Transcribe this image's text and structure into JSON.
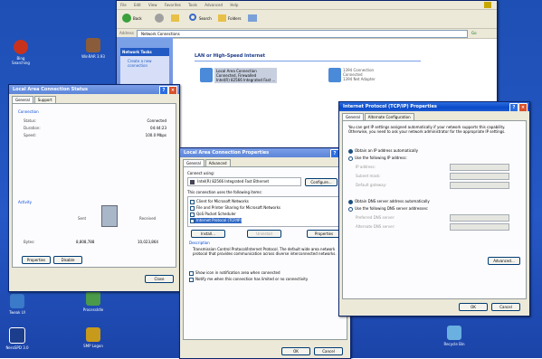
{
  "desktop": {
    "icons": [
      {
        "label": "Bing Searching",
        "color": "#c8321c"
      },
      {
        "label": "WinRAR 3.93",
        "color": "#8a5c3a"
      },
      {
        "label": "Tweak UI",
        "color": "#3a7ac8"
      },
      {
        "label": "ProcessIdle",
        "color": "#4a9a4a"
      },
      {
        "label": "NeroSPD 3.0",
        "color": "#1c3c8c"
      },
      {
        "label": "SMP Logon",
        "color": "#c89a1c"
      },
      {
        "label": "Recycle Bin",
        "color": "#6ab0e0"
      }
    ]
  },
  "explorer": {
    "menu": [
      "File",
      "Edit",
      "View",
      "Favorites",
      "Tools",
      "Advanced",
      "Help"
    ],
    "toolbar": {
      "back": "Back",
      "search": "Search",
      "folders": "Folders"
    },
    "address": {
      "label": "Address",
      "value": "Network Connections",
      "go": "Go"
    },
    "tasks_title": "Network Tasks",
    "tasks": [
      "Create a new connection"
    ],
    "section_title": "LAN or High-Speed Internet",
    "connections": [
      {
        "name": "Local Area Connection",
        "status": "Connected, Firewalled",
        "device": "Intel(R) 82566 Integrated Fast ..."
      },
      {
        "name": "1394 Connection",
        "status": "Connected",
        "device": "1394 Net Adapter"
      }
    ]
  },
  "status_dialog": {
    "title": "Local Area Connection Status",
    "tabs": [
      "General",
      "Support"
    ],
    "connection_label": "Connection",
    "rows": [
      {
        "label": "Status:",
        "value": "Connected"
      },
      {
        "label": "Duration:",
        "value": "04:44:23"
      },
      {
        "label": "Speed:",
        "value": "100.0 Mbps"
      }
    ],
    "activity_label": "Activity",
    "sent": "Sent",
    "received": "Received",
    "bytes_label": "Bytes:",
    "bytes_sent": "8,808,788",
    "bytes_received": "10,023,864",
    "properties": "Properties",
    "disable": "Disable",
    "close": "Close"
  },
  "props_dialog": {
    "title": "Local Area Connection Properties",
    "tabs": [
      "General",
      "Advanced"
    ],
    "connect_using": "Connect using:",
    "adapter": "Intel(R) 82566 Integrated Fast Ethernet",
    "configure": "Configure...",
    "items_label": "This connection uses the following items:",
    "items": [
      "Client for Microsoft Networks",
      "File and Printer Sharing for Microsoft Networks",
      "QoS Packet Scheduler",
      "Internet Protocol (TCP/IP)"
    ],
    "install": "Install...",
    "uninstall": "Uninstall",
    "properties": "Properties",
    "description_label": "Description",
    "description": "Transmission Control Protocol/Internet Protocol. The default wide area network protocol that provides communication across diverse interconnected networks.",
    "show_icon": "Show icon in notification area when connected",
    "notify": "Notify me when this connection has limited or no connectivity",
    "ok": "OK",
    "cancel": "Cancel"
  },
  "tcpip_dialog": {
    "title": "Internet Protocol (TCP/IP) Properties",
    "tabs": [
      "General",
      "Alternate Configuration"
    ],
    "intro": "You can get IP settings assigned automatically if your network supports this capability. Otherwise, you need to ask your network administrator for the appropriate IP settings.",
    "auto_ip": "Obtain an IP address automatically",
    "use_ip": "Use the following IP address:",
    "ip_fields": [
      "IP address:",
      "Subnet mask:",
      "Default gateway:"
    ],
    "auto_dns": "Obtain DNS server address automatically",
    "use_dns": "Use the following DNS server addresses:",
    "dns_fields": [
      "Preferred DNS server:",
      "Alternate DNS server:"
    ],
    "advanced": "Advanced...",
    "ok": "OK",
    "cancel": "Cancel"
  }
}
